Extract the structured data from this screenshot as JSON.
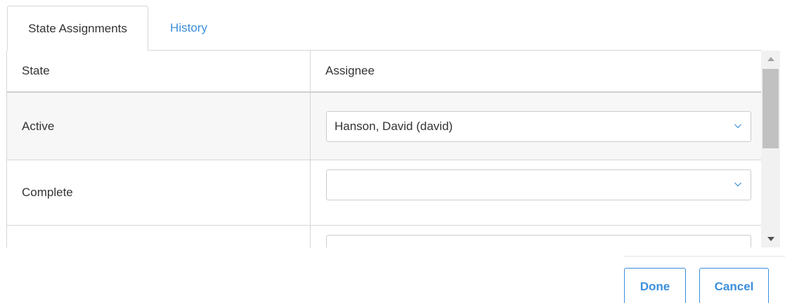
{
  "tabs": [
    {
      "label": "State Assignments",
      "active": true
    },
    {
      "label": "History",
      "active": false
    }
  ],
  "table": {
    "columns": [
      "State",
      "Assignee"
    ],
    "rows": [
      {
        "state": "Active",
        "assignee": "Hanson, David (david)"
      },
      {
        "state": "Complete",
        "assignee": ""
      },
      {
        "state": "",
        "assignee": ""
      }
    ]
  },
  "buttons": {
    "done_label": "Done",
    "cancel_label": "Cancel"
  },
  "colors": {
    "accent": "#3b8fdc",
    "border": "#d6d6d6",
    "row_highlight": "#f7f7f7",
    "scroll_thumb": "#c1c1c1"
  },
  "icons": {
    "dropdown": "chevron-down-icon",
    "scroll_up": "triangle-up-icon",
    "scroll_down": "triangle-down-icon"
  }
}
